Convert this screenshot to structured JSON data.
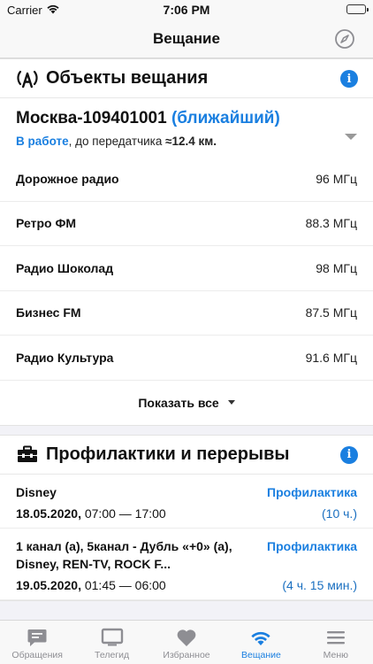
{
  "status_bar": {
    "carrier": "Carrier",
    "time": "7:06 PM"
  },
  "nav": {
    "title": "Вещание"
  },
  "broadcast": {
    "title": "Объекты вещания",
    "station_name": "Москва-109401001",
    "station_nearest": "(ближайший)",
    "status": "В работе",
    "distance_prefix": ", до передатчика ",
    "distance": "≈12.4 км.",
    "frequencies": [
      {
        "name": "Дорожное радио",
        "freq": "96 МГц"
      },
      {
        "name": "Ретро ФМ",
        "freq": "88.3 МГц"
      },
      {
        "name": "Радио Шоколад",
        "freq": "98 МГц"
      },
      {
        "name": "Бизнес FM",
        "freq": "87.5 МГц"
      },
      {
        "name": "Радио Культура",
        "freq": "91.6 МГц"
      }
    ],
    "show_all": "Показать все"
  },
  "maintenance": {
    "title": "Профилактики и перерывы",
    "items": [
      {
        "channels": "Disney",
        "type": "Профилактика",
        "date": "18.05.2020,",
        "time": " 07:00 — 17:00",
        "duration": "(10 ч.)"
      },
      {
        "channels": "1 канал (а), 5канал - Дубль «+0» (а), Disney, REN-TV, ROCK F...",
        "type": "Профилактика",
        "date": "19.05.2020,",
        "time": " 01:45 — 06:00",
        "duration": "(4 ч. 15 мин.)"
      }
    ]
  },
  "tabs": [
    {
      "label": "Обращения",
      "icon": "chat-icon"
    },
    {
      "label": "Телегид",
      "icon": "tv-icon"
    },
    {
      "label": "Избранное",
      "icon": "heart-icon"
    },
    {
      "label": "Вещание",
      "icon": "wifi-icon",
      "active": true
    },
    {
      "label": "Меню",
      "icon": "menu-icon"
    }
  ],
  "colors": {
    "accent": "#1a7fe0",
    "inactive": "#8e8e93"
  }
}
